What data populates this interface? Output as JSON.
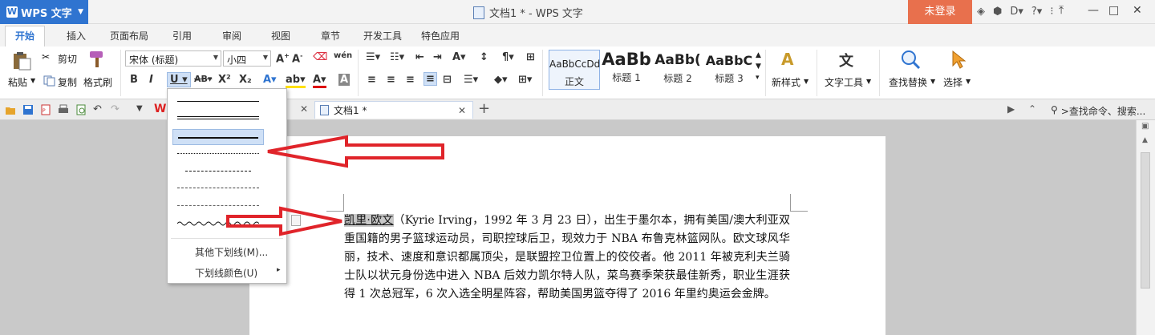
{
  "app": {
    "menu_label": "WPS 文字",
    "logo_glyph": "W",
    "window_title": "文档1 * - WPS 文字",
    "login_label": "未登录",
    "accent_color": "#2f74d0",
    "login_color": "#e8704d"
  },
  "tabs": [
    {
      "label": "开始",
      "active": true
    },
    {
      "label": "插入"
    },
    {
      "label": "页面布局"
    },
    {
      "label": "引用"
    },
    {
      "label": "审阅"
    },
    {
      "label": "视图"
    },
    {
      "label": "章节"
    },
    {
      "label": "开发工具"
    },
    {
      "label": "特色应用"
    }
  ],
  "ribbon": {
    "paste_label": "粘贴",
    "cut_label": "剪切",
    "copy_label": "复制",
    "format_painter_label": "格式刷",
    "font_name": "宋体 (标题)",
    "font_size": "小四",
    "styles": [
      {
        "sample": "AaBbCcDd",
        "label": "正文"
      },
      {
        "sample": "AaBb",
        "label": "标题 1"
      },
      {
        "sample": "AaBb(",
        "label": "标题 2"
      },
      {
        "sample": "AaBbC",
        "label": "标题 3"
      }
    ],
    "new_style_label": "新样式",
    "text_tools_label": "文字工具",
    "find_replace_label": "查找替换",
    "select_label": "选择"
  },
  "doc_tab": {
    "title": "文档1 *"
  },
  "search_cmd": {
    "placeholder": ">查找命令、搜索..."
  },
  "underline_menu": {
    "more_label": "其他下划线(M)...",
    "color_label": "下划线颜色(U)"
  },
  "document": {
    "highlighted_name": "凯里·欧文",
    "body": "（Kyrie Irving，1992 年 3 月 23 日），出生于墨尔本，拥有美国/澳大利亚双重国籍的男子篮球运动员，司职控球后卫，现效力于 NBA 布鲁克林篮网队。欧文球风华丽，技术、速度和意识都属顶尖，是联盟控卫位置上的佼佼者。他 2011 年被克利夫兰骑士队以状元身份选中进入 NBA 后效力凯尔特人队，菜鸟赛季荣获最佳新秀，职业生涯获得 1 次总冠军，6 次入选全明星阵容，帮助美国男篮夺得了 2016 年里约奥运会金牌。"
  }
}
